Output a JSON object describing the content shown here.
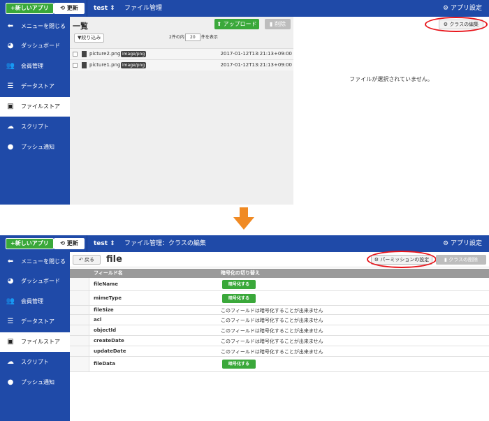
{
  "top": {
    "new_app": "+新しいアプリ",
    "refresh": "更新",
    "app_name": "test",
    "page_title": "ファイル管理",
    "settings": "アプリ設定"
  },
  "sidebar": {
    "items": [
      {
        "label": "メニューを閉じる",
        "icon": "arrow-left-circle-icon"
      },
      {
        "label": "ダッシュボード",
        "icon": "gauge-icon"
      },
      {
        "label": "会員管理",
        "icon": "users-icon"
      },
      {
        "label": "データストア",
        "icon": "database-icon"
      },
      {
        "label": "ファイルストア",
        "icon": "file-icon"
      },
      {
        "label": "スクリプト",
        "icon": "cloud-code-icon"
      },
      {
        "label": "プッシュ通知",
        "icon": "chat-bubble-icon"
      }
    ]
  },
  "filestore": {
    "list_title": "一覧",
    "upload": "アップロード",
    "delete": "削除",
    "filter": "絞り込み",
    "count_prefix": "2件の内",
    "per_page": "20",
    "count_suffix": "件を表示",
    "files": [
      {
        "name": "picture2.png",
        "type": "image/png",
        "date": "2017-01-12T13:21:13+09:00"
      },
      {
        "name": "picture1.png",
        "type": "image/png",
        "date": "2017-01-12T13:21:13+09:00"
      }
    ],
    "class_edit": "クラスの編集",
    "empty_message": "ファイルが選択されていません。"
  },
  "classedit": {
    "page_title": "ファイル管理：クラスの編集",
    "back": "戻る",
    "class_name": "file",
    "permission": "パーミッションの設定",
    "delete_class": "クラスの削除",
    "col_field": "フィールド名",
    "col_encrypt": "暗号化の切り替え",
    "encrypt_button": "暗号化する",
    "not_encryptable": "このフィールドは暗号化することが出来ません",
    "fields": [
      "fileName",
      "mimeType",
      "fileSize",
      "acl",
      "objectId",
      "createDate",
      "updateDate",
      "fileData"
    ]
  },
  "colors": {
    "brand": "#1f4aa8",
    "green": "#3aa83a",
    "highlight": "#e8141a",
    "arrow": "#f08a24"
  }
}
